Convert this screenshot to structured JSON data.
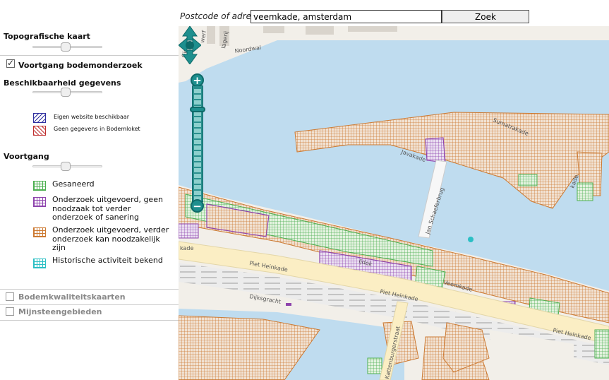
{
  "search": {
    "label": "Postcode of adres",
    "value": "veemkade, amsterdam",
    "button": "Zoek"
  },
  "sidebar": {
    "topo_heading": "Topografische kaart",
    "progress_layer": {
      "label": "Voortgang bodemonderzoek",
      "checked": true
    },
    "availability_heading": "Beschikbaarheid gegevens",
    "availability_legend": [
      {
        "label": "Eigen website beschikbaar",
        "color": "#3030a0"
      },
      {
        "label": "Geen gegevens in Bodemloket",
        "color": "#c03030"
      }
    ],
    "progress_heading": "Voortgang",
    "progress_legend": [
      {
        "label": "Gesaneerd",
        "color": "#4caf50"
      },
      {
        "label": "Onderzoek uitgevoerd, geen noodzaak tot verder onderzoek of sanering",
        "color": "#8e44ad"
      },
      {
        "label": "Onderzoek uitgevoerd, verder onderzoek kan noodzakelijk zijn",
        "color": "#cc7a33"
      },
      {
        "label": "Historische activiteit bekend",
        "color": "#2bbfc4"
      }
    ],
    "collapsed": [
      {
        "label": "Bodemkwaliteitskaarten",
        "checked": false
      },
      {
        "label": "Mijnsteengebieden",
        "checked": false
      }
    ]
  },
  "map": {
    "street_labels": {
      "piet_heinkade_1": "Piet Heinkade",
      "piet_heinkade_2": "Piet Heinkade",
      "piet_heinkade_3": "Piet Heinkade",
      "jan_schaeferbrug": "Jan Schaeferbrug",
      "dijksgracht": "Dijksgracht",
      "kattenburgerstraat": "Kattenburgerstraat",
      "noordwal": "Noordwal",
      "sumatrakade": "Sumatrakade",
      "javakade": "Javakade",
      "veemkade": "Veemkade",
      "ijdok": "Ijdok",
      "kade": "kade",
      "kade_left": "kade",
      "werf": "werf",
      "slagerij": "lagerij",
      "gietrij": "Gietrij"
    },
    "colors": {
      "water": "#bfdcef",
      "land": "#f2efe9",
      "road": "#fbeec4",
      "rail": "#cfcfcf",
      "orange": "#cc7a33",
      "green": "#4caf50",
      "purple": "#8e44ad",
      "cyan": "#2bbfc4"
    }
  },
  "controls": {
    "pan": "pan-control",
    "zoom_in": "+",
    "zoom_out": "−",
    "zoom_level_fraction": 0.2
  }
}
